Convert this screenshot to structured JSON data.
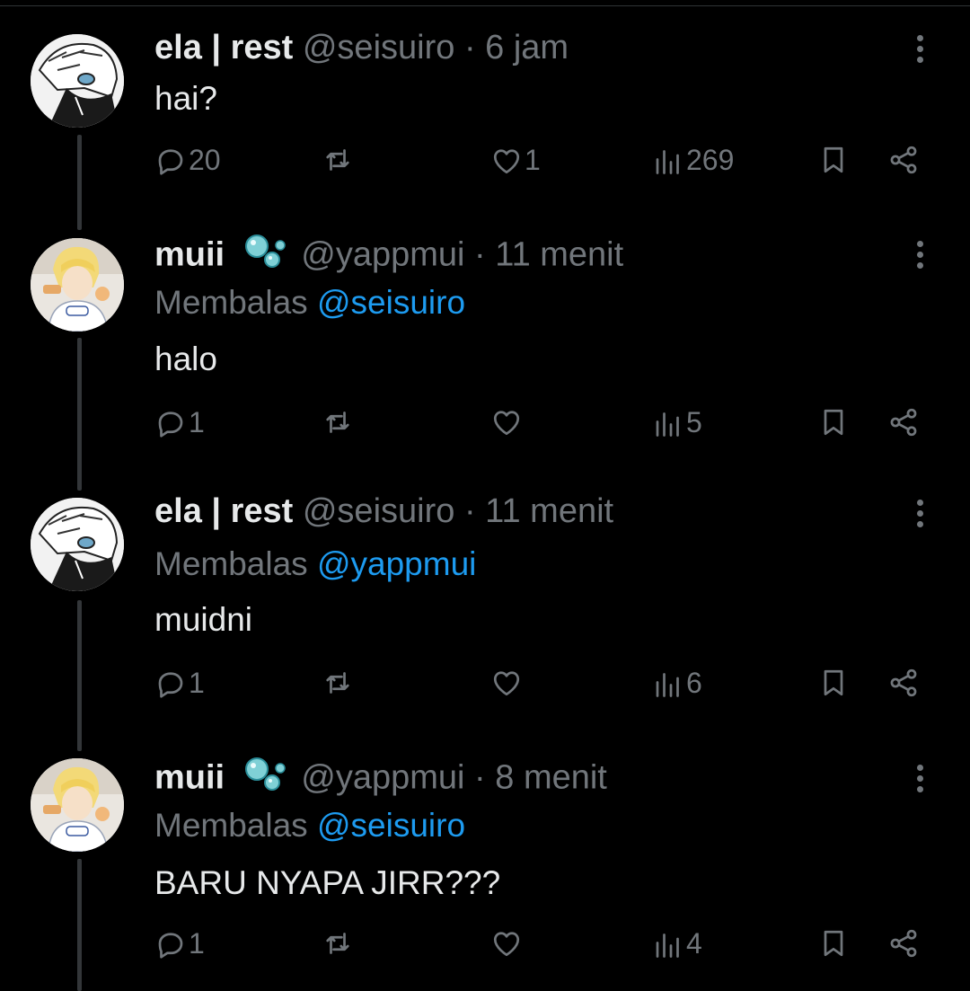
{
  "tweets": [
    {
      "name": "ela | rest",
      "handle": "@seisuiro",
      "time": "6 jam",
      "reply_prefix": "",
      "reply_mention": "",
      "text": "hai?",
      "replies": "20",
      "retweets": "",
      "likes": "1",
      "views": "269",
      "avatar": "manga-boy-avatar",
      "emoji": ""
    },
    {
      "name": "muii",
      "handle": "@yappmui",
      "time": "11 menit",
      "reply_prefix": "Membalas",
      "reply_mention": "@seisuiro",
      "text": "halo",
      "replies": "1",
      "retweets": "",
      "likes": "",
      "views": "5",
      "avatar": "blonde-anime-avatar",
      "emoji": "bubbles-emoji"
    },
    {
      "name": "ela | rest",
      "handle": "@seisuiro",
      "time": "11 menit",
      "reply_prefix": "Membalas",
      "reply_mention": "@yappmui",
      "text": "muidni",
      "replies": "1",
      "retweets": "",
      "likes": "",
      "views": "6",
      "avatar": "manga-boy-avatar",
      "emoji": ""
    },
    {
      "name": "muii",
      "handle": "@yappmui",
      "time": "8 menit",
      "reply_prefix": "Membalas",
      "reply_mention": "@seisuiro",
      "text": "BARU NYAPA JIRR???",
      "replies": "1",
      "retweets": "",
      "likes": "",
      "views": "4",
      "avatar": "blonde-anime-avatar",
      "emoji": "bubbles-emoji"
    }
  ],
  "separator": "·",
  "icons": {
    "reply": "reply-icon",
    "retweet": "retweet-icon",
    "like": "heart-icon",
    "views": "views-icon",
    "bookmark": "bookmark-icon",
    "share": "share-icon",
    "more": "more-icon"
  },
  "colors": {
    "background": "#000000",
    "text": "#e7e9ea",
    "muted": "#71767b",
    "mention": "#1d9bf0",
    "thread_line": "#333639"
  }
}
